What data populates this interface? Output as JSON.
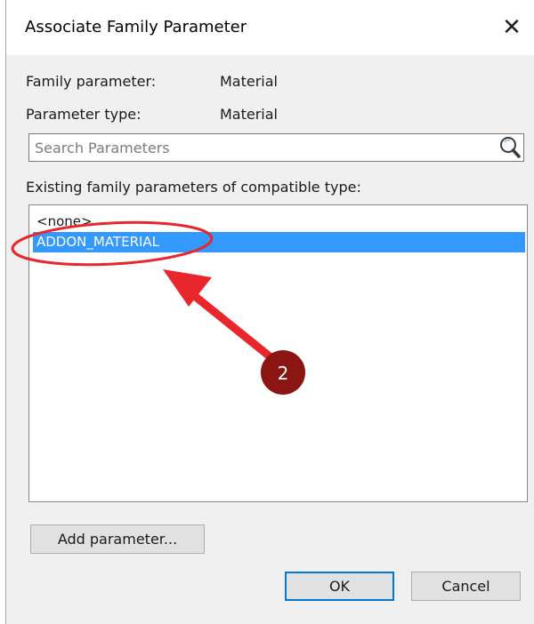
{
  "dialog": {
    "title": "Associate Family Parameter",
    "close_glyph": "✕"
  },
  "info": {
    "family_parameter_label": "Family parameter:",
    "family_parameter_value": "Material",
    "parameter_type_label": "Parameter type:",
    "parameter_type_value": "Material"
  },
  "search": {
    "placeholder": "Search Parameters",
    "value": "",
    "icon": "search-icon"
  },
  "list": {
    "header": "Existing family parameters of compatible type:",
    "items": [
      {
        "label": "<none>",
        "selected": false
      },
      {
        "label": "ADDON_MATERIAL",
        "selected": true
      }
    ]
  },
  "buttons": {
    "add_parameter": "Add parameter...",
    "ok": "OK",
    "cancel": "Cancel"
  },
  "annotation": {
    "badge_number": "2",
    "arrow_color": "#e8262b",
    "badge_color": "#8b1513",
    "ellipse_color": "#e8262b"
  },
  "colors": {
    "selection": "#3399ff",
    "default_button_border": "#0078d7"
  }
}
